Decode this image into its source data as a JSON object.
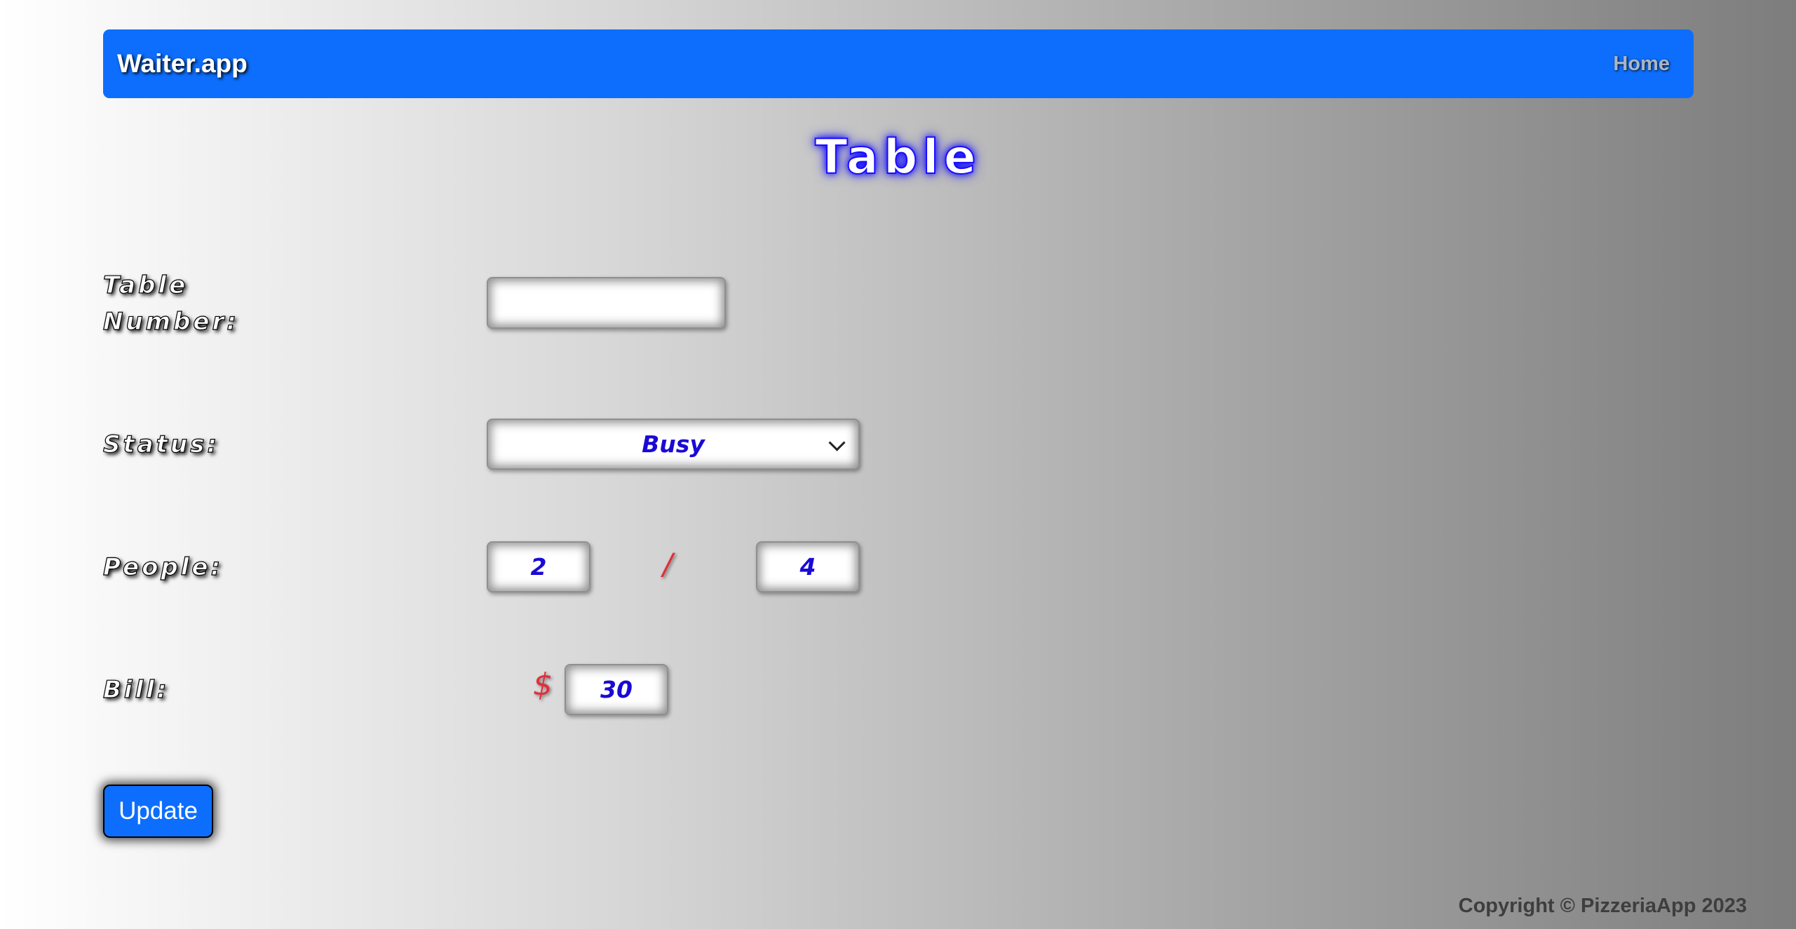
{
  "navbar": {
    "brand": "Waiter.app",
    "home_link": "Home"
  },
  "page": {
    "title": "Table"
  },
  "form": {
    "table_number": {
      "label": "Table Number:",
      "value": ""
    },
    "status": {
      "label": "Status:",
      "selected": "Busy"
    },
    "people": {
      "label": "People:",
      "current": "2",
      "separator": "/",
      "max": "4"
    },
    "bill": {
      "label": "Bill:",
      "currency": "$",
      "value": "30"
    },
    "submit_label": "Update"
  },
  "footer": {
    "copyright": "Copyright © PizzeriaApp 2023"
  },
  "colors": {
    "primary": "#0d6efd",
    "input_text": "#1a0ad6",
    "accent_red": "#e0303b",
    "title_glow": "#1a0dff"
  },
  "icons": {
    "status_dropdown": "chevron-down-icon"
  }
}
